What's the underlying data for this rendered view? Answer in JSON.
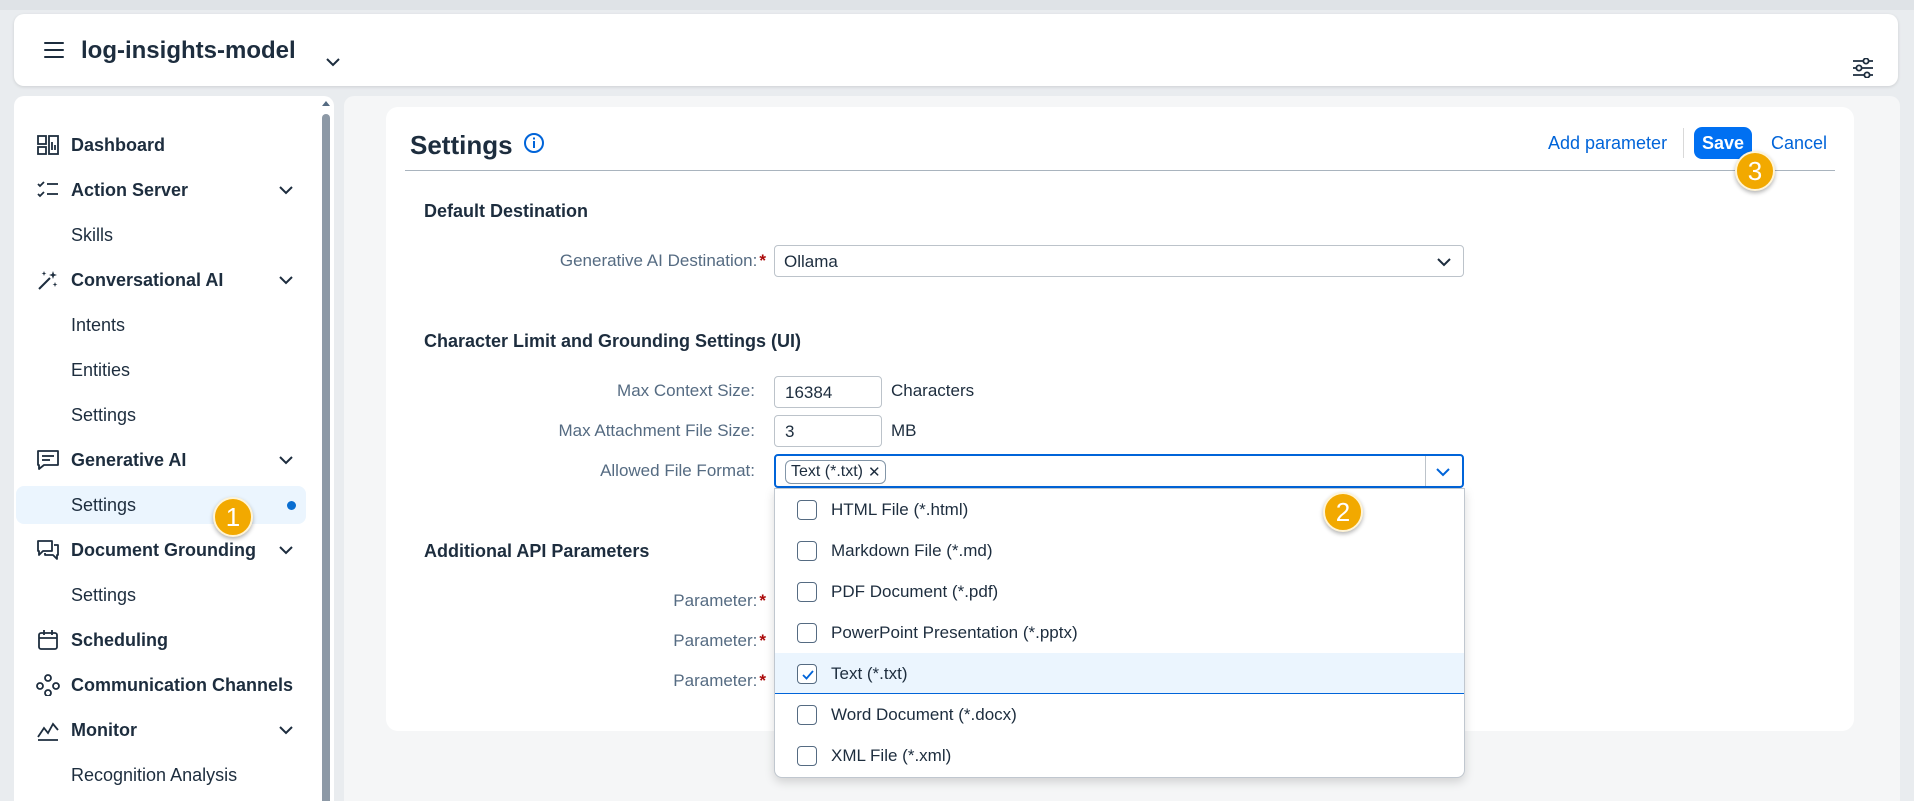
{
  "shell": {
    "title": "log-insights-model"
  },
  "sidebar": {
    "items": [
      {
        "label": "Dashboard",
        "type": "group",
        "icon": "dashboard-icon"
      },
      {
        "label": "Action Server",
        "type": "group",
        "icon": "checklist-icon",
        "expandable": true
      },
      {
        "label": "Skills",
        "type": "sub"
      },
      {
        "label": "Conversational AI",
        "type": "group",
        "icon": "sparkle-icon",
        "expandable": true
      },
      {
        "label": "Intents",
        "type": "sub"
      },
      {
        "label": "Entities",
        "type": "sub"
      },
      {
        "label": "Settings",
        "type": "sub"
      },
      {
        "label": "Generative AI",
        "type": "group",
        "icon": "chat-icon",
        "expandable": true
      },
      {
        "label": "Settings",
        "type": "sub",
        "selected": true
      },
      {
        "label": "Document Grounding",
        "type": "group",
        "icon": "discussion-icon",
        "expandable": true
      },
      {
        "label": "Settings",
        "type": "sub"
      },
      {
        "label": "Scheduling",
        "type": "group",
        "icon": "calendar-icon"
      },
      {
        "label": "Communication Channels",
        "type": "group",
        "icon": "network-icon"
      },
      {
        "label": "Monitor",
        "type": "group",
        "icon": "line-chart-icon",
        "expandable": true
      },
      {
        "label": "Recognition Analysis",
        "type": "sub"
      }
    ]
  },
  "card": {
    "title": "Settings",
    "add_parameter": "Add parameter",
    "save": "Save",
    "cancel": "Cancel"
  },
  "default_destination": {
    "section_title": "Default Destination",
    "label": "Generative AI Destination:",
    "value": "Ollama"
  },
  "limits": {
    "section_title": "Character Limit and Grounding Settings (UI)",
    "max_context_label": "Max Context Size:",
    "max_context_value": "16384",
    "max_context_unit": "Characters",
    "max_attach_label": "Max Attachment File Size:",
    "max_attach_value": "3",
    "max_attach_unit": "MB",
    "allowed_format_label": "Allowed File Format:",
    "token": "Text (*.txt)"
  },
  "file_formats": [
    {
      "label": "HTML File (*.html)",
      "checked": false
    },
    {
      "label": "Markdown File (*.md)",
      "checked": false
    },
    {
      "label": "PDF Document (*.pdf)",
      "checked": false
    },
    {
      "label": "PowerPoint Presentation (*.pptx)",
      "checked": false
    },
    {
      "label": "Text (*.txt)",
      "checked": true
    },
    {
      "label": "Word Document (*.docx)",
      "checked": false
    },
    {
      "label": "XML File (*.xml)",
      "checked": false
    }
  ],
  "api_params": {
    "section_title": "Additional API Parameters",
    "labels": [
      "Parameter:",
      "Parameter:",
      "Parameter:"
    ]
  },
  "badges": [
    "1",
    "2",
    "3"
  ],
  "colors": {
    "accent": "#0070f2",
    "badge": "#f2a900",
    "required": "#aa0808"
  }
}
